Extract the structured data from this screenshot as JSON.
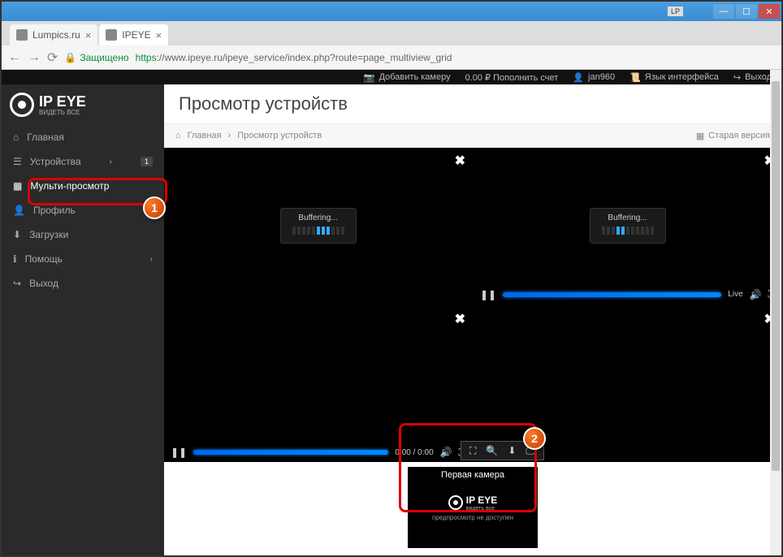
{
  "window": {
    "lp_badge": "LP"
  },
  "tabs": [
    {
      "title": "Lumpics.ru"
    },
    {
      "title": "IPEYE"
    }
  ],
  "address": {
    "secure_label": "Защищено",
    "protocol": "https",
    "url_rest": "://www.ipeye.ru/ipeye_service/index.php?route=page_multiview_grid"
  },
  "header": {
    "add_camera": "Добавить камеру",
    "balance": "0.00 ₽ Пополнить счет",
    "user": "jan960",
    "lang": "Язык интерфейса",
    "exit": "Выход"
  },
  "logo": {
    "main": "IP EYE",
    "sub": "ВИДЕТЬ ВСЕ"
  },
  "sidebar": {
    "items": [
      {
        "icon": "home",
        "label": "Главная"
      },
      {
        "icon": "list",
        "label": "Устройства",
        "chev": "›",
        "badge": "1"
      },
      {
        "icon": "grid",
        "label": "Мульти-просмотр"
      },
      {
        "icon": "user",
        "label": "Профиль",
        "chev": "›"
      },
      {
        "icon": "download",
        "label": "Загрузки"
      },
      {
        "icon": "info",
        "label": "Помощь",
        "chev": "›"
      },
      {
        "icon": "exit",
        "label": "Выход"
      }
    ]
  },
  "page": {
    "title": "Просмотр устройств",
    "breadcrumb_home": "Главная",
    "breadcrumb_sep": "›",
    "breadcrumb_current": "Просмотр устройств",
    "old_version": "Старая версия"
  },
  "video": {
    "buffering": "Buffering...",
    "live": "Live",
    "time": "0:00 / 0:00"
  },
  "thumbnail": {
    "title": "Первая камера",
    "logo": "IP EYE",
    "logo_sub": "видеть все",
    "no_preview": "предпросмотр не доступен"
  },
  "callouts": {
    "n1": "1",
    "n2": "2"
  }
}
